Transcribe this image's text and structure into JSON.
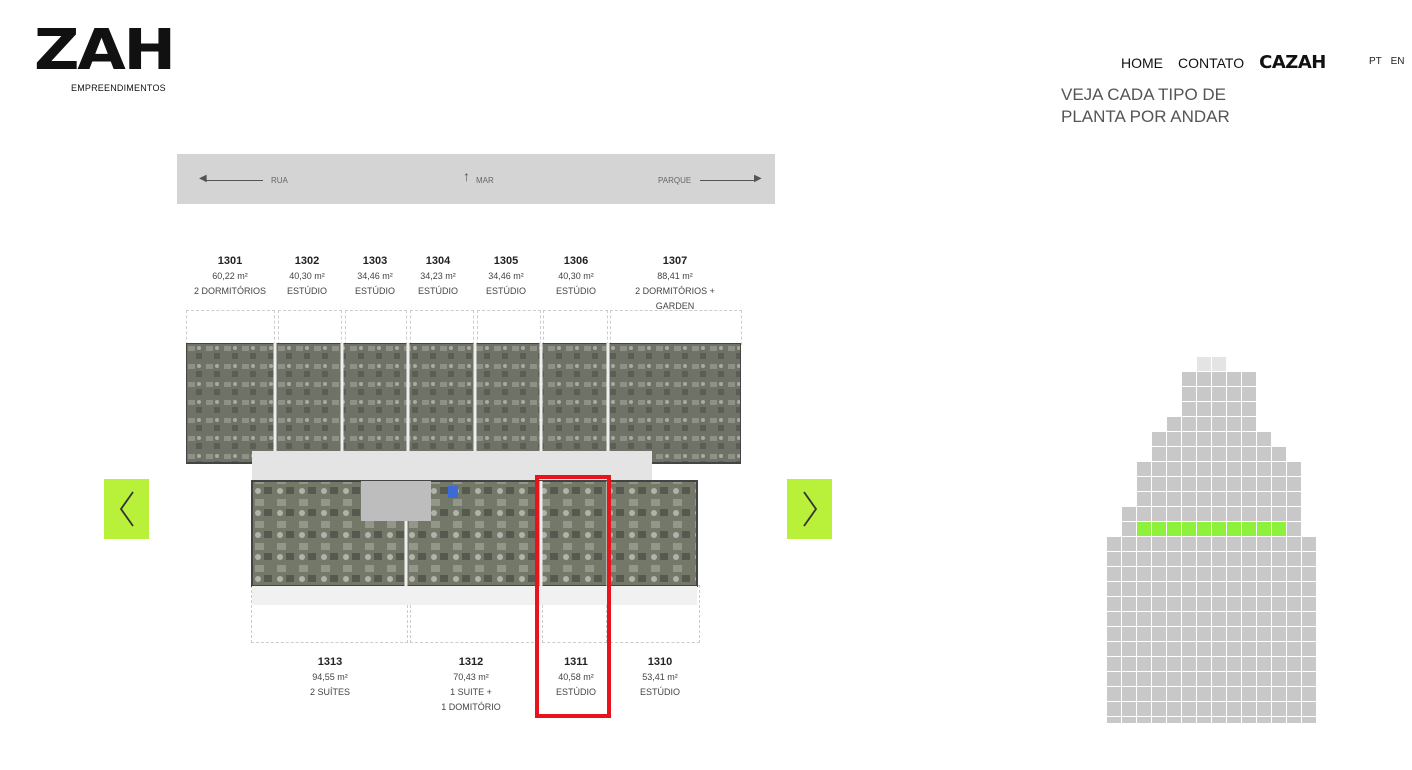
{
  "header": {
    "logo_word": "ZAH",
    "logo_sub": "EMPREENDIMENTOS",
    "nav": [
      {
        "label": "HOME"
      },
      {
        "label": "CONTATO"
      }
    ],
    "nav_brand": "CAZAH",
    "lang": [
      "PT",
      "EN"
    ]
  },
  "headline": "VEJA CADA TIPO DE PLANTA POR ANDAR",
  "orientation": {
    "left": "RUA",
    "center": "MAR",
    "right": "PARQUE"
  },
  "units_top": [
    {
      "num": "1301",
      "area": "60,22 m²",
      "type": "2 DORMITÓRIOS"
    },
    {
      "num": "1302",
      "area": "40,30 m²",
      "type": "ESTÚDIO"
    },
    {
      "num": "1303",
      "area": "34,46 m²",
      "type": "ESTÚDIO"
    },
    {
      "num": "1304",
      "area": "34,23 m²",
      "type": "ESTÚDIO"
    },
    {
      "num": "1305",
      "area": "34,46 m²",
      "type": "ESTÚDIO"
    },
    {
      "num": "1306",
      "area": "40,30 m²",
      "type": "ESTÚDIO"
    },
    {
      "num": "1307",
      "area": "88,41 m²",
      "type": "2 DORMITÓRIOS + GARDEN"
    }
  ],
  "units_bottom": [
    {
      "num": "1313",
      "area": "94,55 m²",
      "type": "2 SUÍTES",
      "type2": ""
    },
    {
      "num": "1312",
      "area": "70,43 m²",
      "type": "1 SUITE +",
      "type2": "1 DOMITÓRIO"
    },
    {
      "num": "1311",
      "area": "40,58 m²",
      "type": "ESTÚDIO",
      "type2": ""
    },
    {
      "num": "1310",
      "area": "53,41 m²",
      "type": "ESTÚDIO",
      "type2": ""
    }
  ],
  "colors": {
    "accent": "#b8f03a",
    "highlight": "#e8141c",
    "floor_active": "#8ef23c",
    "tower": "#c8c8c8"
  },
  "icons": {
    "prev": "chevron-left-icon",
    "next": "chevron-right-icon"
  }
}
